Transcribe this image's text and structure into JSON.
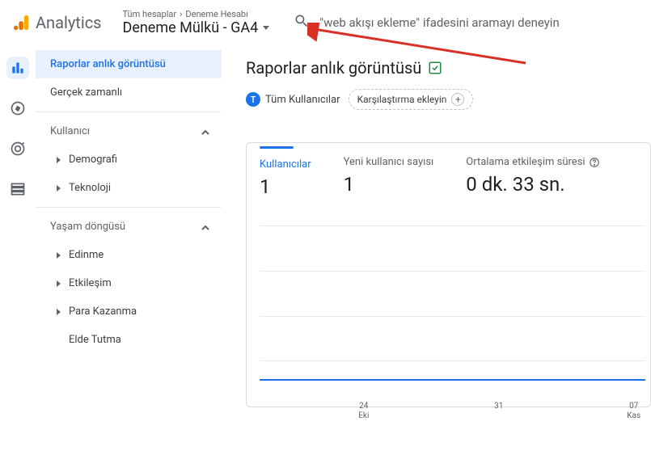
{
  "header": {
    "brand": "Analytics",
    "breadcrumb_all": "Tüm hesaplar",
    "breadcrumb_account": "Deneme Hesabı",
    "property": "Deneme Mülkü - GA4",
    "search_placeholder": "\"web akışı ekleme\" ifadesini aramayı deneyin"
  },
  "sidebar": {
    "reports_snapshot": "Raporlar anlık görüntüsü",
    "realtime": "Gerçek zamanlı",
    "section_user": "Kullanıcı",
    "user_items": [
      "Demografi",
      "Teknoloji"
    ],
    "section_lifecycle": "Yaşam döngüsü",
    "lifecycle_items": [
      "Edinme",
      "Etkileşim",
      "Para Kazanma",
      "Elde Tutma"
    ]
  },
  "main": {
    "title": "Raporlar anlık görüntüsü",
    "chip_all_users": "Tüm Kullanıcılar",
    "chip_t": "T",
    "chip_compare": "Karşılaştırma ekleyin",
    "chip_plus": "+"
  },
  "chart_data": {
    "type": "line",
    "metrics": [
      {
        "label": "Kullanıcılar",
        "value": "1",
        "active": true
      },
      {
        "label": "Yeni kullanıcı sayısı",
        "value": "1",
        "active": false
      },
      {
        "label": "Ortalama etkileşim süresi",
        "value": "0 dk. 33 sn.",
        "active": false,
        "help": true
      }
    ],
    "x_ticks": [
      {
        "pos": 27,
        "l1": "24",
        "l2": "Eki"
      },
      {
        "pos": 62,
        "l1": "31",
        "l2": ""
      },
      {
        "pos": 97,
        "l1": "07",
        "l2": "Kas"
      }
    ],
    "gridlines_pct": [
      10,
      33,
      56,
      79
    ]
  }
}
